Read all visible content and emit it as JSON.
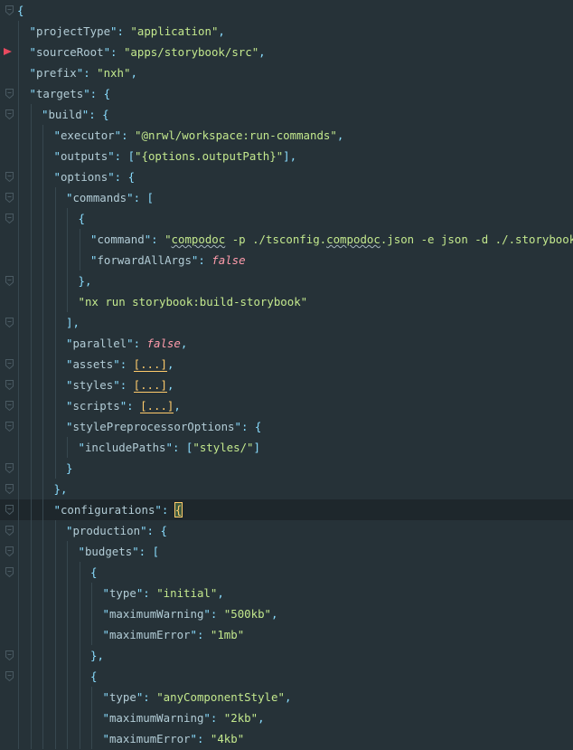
{
  "editor": {
    "theme_colors": {
      "background": "#263238",
      "key": "#b2ccd6",
      "string": "#c3e88d",
      "punctuation": "#89ddff",
      "boolean": "#ff9cac",
      "breakpoint": "#e84a5f"
    },
    "lines": [
      {
        "indent": 0,
        "fold": true,
        "tokens": [
          [
            "p",
            "{"
          ]
        ]
      },
      {
        "indent": 1,
        "tokens": [
          [
            "key",
            "\"projectType\""
          ],
          [
            "p",
            ": "
          ],
          [
            "s",
            "\"application\""
          ],
          [
            "p",
            ","
          ]
        ]
      },
      {
        "indent": 1,
        "breakpoint": true,
        "tokens": [
          [
            "key",
            "\"sourceRoot\""
          ],
          [
            "p",
            ": "
          ],
          [
            "s",
            "\"apps/storybook/src\""
          ],
          [
            "p",
            ","
          ]
        ]
      },
      {
        "indent": 1,
        "tokens": [
          [
            "key",
            "\"prefix\""
          ],
          [
            "p",
            ": "
          ],
          [
            "s",
            "\"nxh\""
          ],
          [
            "p",
            ","
          ]
        ]
      },
      {
        "indent": 1,
        "fold": true,
        "tokens": [
          [
            "key",
            "\"targets\""
          ],
          [
            "p",
            ": {"
          ]
        ]
      },
      {
        "indent": 2,
        "fold": true,
        "tokens": [
          [
            "key",
            "\"build\""
          ],
          [
            "p",
            ": {"
          ]
        ]
      },
      {
        "indent": 3,
        "tokens": [
          [
            "key",
            "\"executor\""
          ],
          [
            "p",
            ": "
          ],
          [
            "s",
            "\"@nrwl/workspace:run-commands\""
          ],
          [
            "p",
            ","
          ]
        ]
      },
      {
        "indent": 3,
        "tokens": [
          [
            "key",
            "\"outputs\""
          ],
          [
            "p",
            ": ["
          ],
          [
            "s",
            "\"{options.outputPath}\""
          ],
          [
            "p",
            "],"
          ]
        ]
      },
      {
        "indent": 3,
        "fold": true,
        "tokens": [
          [
            "key",
            "\"options\""
          ],
          [
            "p",
            ": {"
          ]
        ]
      },
      {
        "indent": 4,
        "fold": true,
        "tokens": [
          [
            "key",
            "\"commands\""
          ],
          [
            "p",
            ": ["
          ]
        ]
      },
      {
        "indent": 5,
        "fold": true,
        "tokens": [
          [
            "p",
            "{"
          ]
        ]
      },
      {
        "indent": 6,
        "tokens": [
          [
            "key",
            "\"command\""
          ],
          [
            "p",
            ": "
          ],
          [
            "s",
            "\""
          ],
          [
            "typo",
            "compodoc"
          ],
          [
            "s",
            " -p ./tsconfig."
          ],
          [
            "typo",
            "compodoc"
          ],
          [
            "s",
            ".json -e json -d ./.storybook\""
          ],
          [
            "p",
            ","
          ]
        ]
      },
      {
        "indent": 6,
        "tokens": [
          [
            "key",
            "\"forwardAllArgs\""
          ],
          [
            "p",
            ": "
          ],
          [
            "b",
            "false"
          ]
        ]
      },
      {
        "indent": 5,
        "fold": true,
        "tokens": [
          [
            "p",
            "},"
          ]
        ]
      },
      {
        "indent": 5,
        "tokens": [
          [
            "s",
            "\"nx run storybook:build-storybook\""
          ]
        ]
      },
      {
        "indent": 4,
        "fold": true,
        "tokens": [
          [
            "p",
            "],"
          ]
        ]
      },
      {
        "indent": 4,
        "tokens": [
          [
            "key",
            "\"parallel\""
          ],
          [
            "p",
            ": "
          ],
          [
            "b",
            "false"
          ],
          [
            "p",
            ","
          ]
        ]
      },
      {
        "indent": 4,
        "fold": true,
        "tokens": [
          [
            "key",
            "\"assets\""
          ],
          [
            "p",
            ": "
          ],
          [
            "ph",
            "[...]"
          ],
          [
            "p",
            ","
          ]
        ]
      },
      {
        "indent": 4,
        "fold": true,
        "tokens": [
          [
            "key",
            "\"styles\""
          ],
          [
            "p",
            ": "
          ],
          [
            "ph",
            "[...]"
          ],
          [
            "p",
            ","
          ]
        ]
      },
      {
        "indent": 4,
        "fold": true,
        "tokens": [
          [
            "key",
            "\"scripts\""
          ],
          [
            "p",
            ": "
          ],
          [
            "ph",
            "[...]"
          ],
          [
            "p",
            ","
          ]
        ]
      },
      {
        "indent": 4,
        "fold": true,
        "tokens": [
          [
            "key",
            "\"stylePreprocessorOptions\""
          ],
          [
            "p",
            ": {"
          ]
        ]
      },
      {
        "indent": 5,
        "tokens": [
          [
            "key",
            "\"includePaths\""
          ],
          [
            "p",
            ": ["
          ],
          [
            "s",
            "\"styles/\""
          ],
          [
            "p",
            "]"
          ]
        ]
      },
      {
        "indent": 4,
        "fold": true,
        "tokens": [
          [
            "p",
            "}"
          ]
        ]
      },
      {
        "indent": 3,
        "fold": true,
        "tokens": [
          [
            "p",
            "},"
          ]
        ]
      },
      {
        "indent": 3,
        "fold": true,
        "current": true,
        "tokens": [
          [
            "key",
            "\"configurations\""
          ],
          [
            "p",
            ": "
          ],
          [
            "cur",
            "{"
          ]
        ]
      },
      {
        "indent": 4,
        "fold": true,
        "tokens": [
          [
            "key",
            "\"production\""
          ],
          [
            "p",
            ": {"
          ]
        ]
      },
      {
        "indent": 5,
        "fold": true,
        "tokens": [
          [
            "key",
            "\"budgets\""
          ],
          [
            "p",
            ": ["
          ]
        ]
      },
      {
        "indent": 6,
        "fold": true,
        "tokens": [
          [
            "p",
            "{"
          ]
        ]
      },
      {
        "indent": 7,
        "tokens": [
          [
            "key",
            "\"type\""
          ],
          [
            "p",
            ": "
          ],
          [
            "s",
            "\"initial\""
          ],
          [
            "p",
            ","
          ]
        ]
      },
      {
        "indent": 7,
        "tokens": [
          [
            "key",
            "\"maximumWarning\""
          ],
          [
            "p",
            ": "
          ],
          [
            "s",
            "\"500kb\""
          ],
          [
            "p",
            ","
          ]
        ]
      },
      {
        "indent": 7,
        "tokens": [
          [
            "key",
            "\"maximumError\""
          ],
          [
            "p",
            ": "
          ],
          [
            "s",
            "\"1mb\""
          ]
        ]
      },
      {
        "indent": 6,
        "fold": true,
        "tokens": [
          [
            "p",
            "},"
          ]
        ]
      },
      {
        "indent": 6,
        "fold": true,
        "tokens": [
          [
            "p",
            "{"
          ]
        ]
      },
      {
        "indent": 7,
        "tokens": [
          [
            "key",
            "\"type\""
          ],
          [
            "p",
            ": "
          ],
          [
            "s",
            "\"anyComponentStyle\""
          ],
          [
            "p",
            ","
          ]
        ]
      },
      {
        "indent": 7,
        "tokens": [
          [
            "key",
            "\"maximumWarning\""
          ],
          [
            "p",
            ": "
          ],
          [
            "s",
            "\"2kb\""
          ],
          [
            "p",
            ","
          ]
        ]
      },
      {
        "indent": 7,
        "tokens": [
          [
            "key",
            "\"maximumError\""
          ],
          [
            "p",
            ": "
          ],
          [
            "s",
            "\"4kb\""
          ]
        ]
      }
    ]
  }
}
